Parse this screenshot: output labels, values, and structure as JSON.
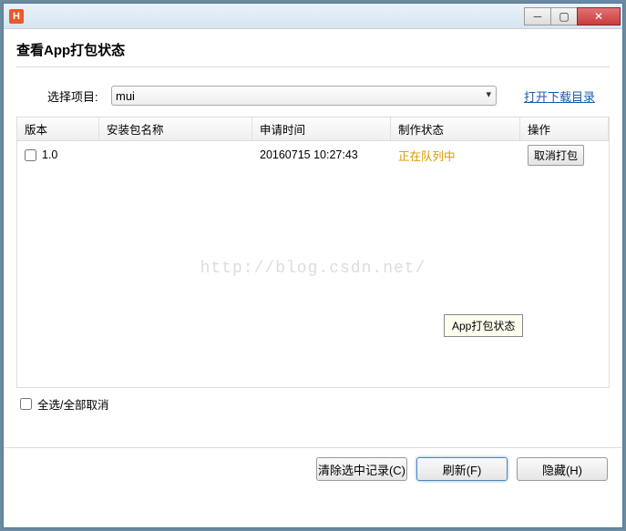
{
  "window": {
    "app_icon_text": "H",
    "title": ""
  },
  "dialog": {
    "title": "查看App打包状态"
  },
  "project": {
    "label": "选择项目:",
    "selected": "mui",
    "open_download_dir": "打开下载目录"
  },
  "table": {
    "headers": {
      "version": "版本",
      "package_name": "安装包名称",
      "apply_time": "申请时间",
      "status": "制作状态",
      "operation": "操作"
    },
    "rows": [
      {
        "version": "1.0",
        "package_name": "",
        "apply_time": "20160715 10:27:43",
        "status": "正在队列中",
        "op_label": "取消打包"
      }
    ]
  },
  "watermark": "http://blog.csdn.net/",
  "tooltip": "App打包状态",
  "select_all": {
    "label": "全选/全部取消"
  },
  "footer": {
    "clear": "清除选中记录(C)",
    "refresh": "刷新(F)",
    "hide": "隐藏(H)"
  }
}
